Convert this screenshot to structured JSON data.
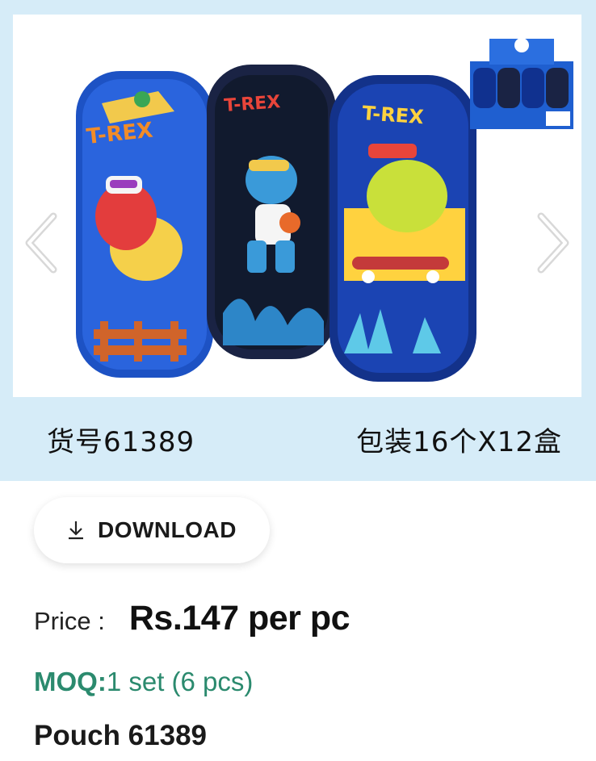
{
  "gallery": {
    "image_alt": "Three T-REX dinosaur pencil pouches",
    "thumb_alt": "Display box of pouches",
    "pouch_text": "T-REX",
    "caption_left": "货号61389",
    "caption_right": "包装16个X12盒",
    "prev_icon": "chevron-left-icon",
    "next_icon": "chevron-right-icon"
  },
  "actions": {
    "download_label": "DOWNLOAD",
    "download_icon": "download-icon"
  },
  "product": {
    "price_label": "Price :",
    "price_value": "Rs.147 per pc",
    "moq_label": "MOQ:",
    "moq_value": "1 set (6 pcs)",
    "name": "Pouch 61389"
  },
  "colors": {
    "hero_bg": "#d6ecf8",
    "moq_green": "#2b8a6e",
    "pouch_blue": "#1d52c4",
    "pouch_navy": "#1a2344"
  }
}
